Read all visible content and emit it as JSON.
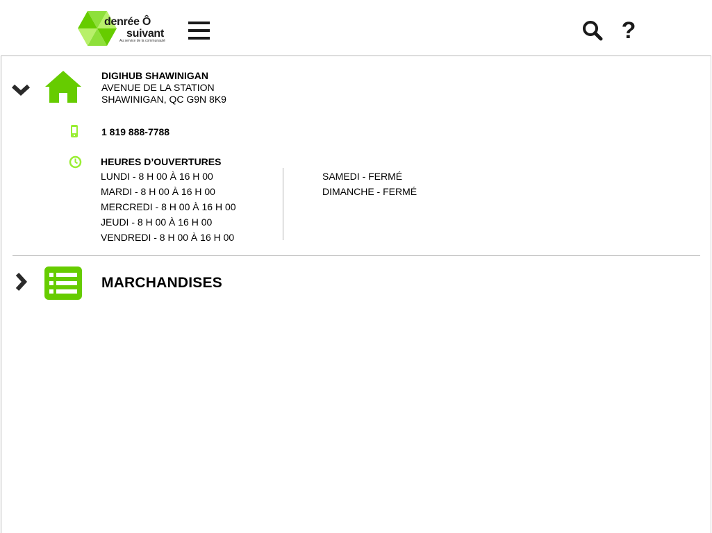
{
  "header": {
    "logo": {
      "line1": "denrée Ô",
      "line2": "suivant",
      "tagline": "Au service de la communauté"
    },
    "icons": [
      "hamburger-menu-icon",
      "search-icon",
      "help-icon"
    ],
    "help_label": "?"
  },
  "location": {
    "name": "DIGIHUB SHAWINIGAN",
    "address_line1": "AVENUE DE LA STATION",
    "address_line2": "SHAWINIGAN, QC G9N 8K9",
    "phone": "1 819 888-7788",
    "hours_title": "HEURES D’OUVERTURES",
    "hours_left": [
      "LUNDI - 8 H 00 À 16 H 00",
      "MARDI - 8 H 00 À 16 H 00",
      "MERCREDI - 8 H 00 À 16 H 00",
      "JEUDI - 8 H 00 À 16 H 00",
      "VENDREDI - 8 H 00 À 16 H 00"
    ],
    "hours_right": [
      "SAMEDI - FERMÉ",
      "DIMANCHE - FERMÉ"
    ],
    "expanded": true
  },
  "merchandise": {
    "title": "MARCHANDISES",
    "expanded": false
  },
  "colors": {
    "accent_green": "#66cc00",
    "light_green": "#99ee33",
    "dark_text": "#1a1a1a",
    "divider": "#b7b7b7"
  }
}
